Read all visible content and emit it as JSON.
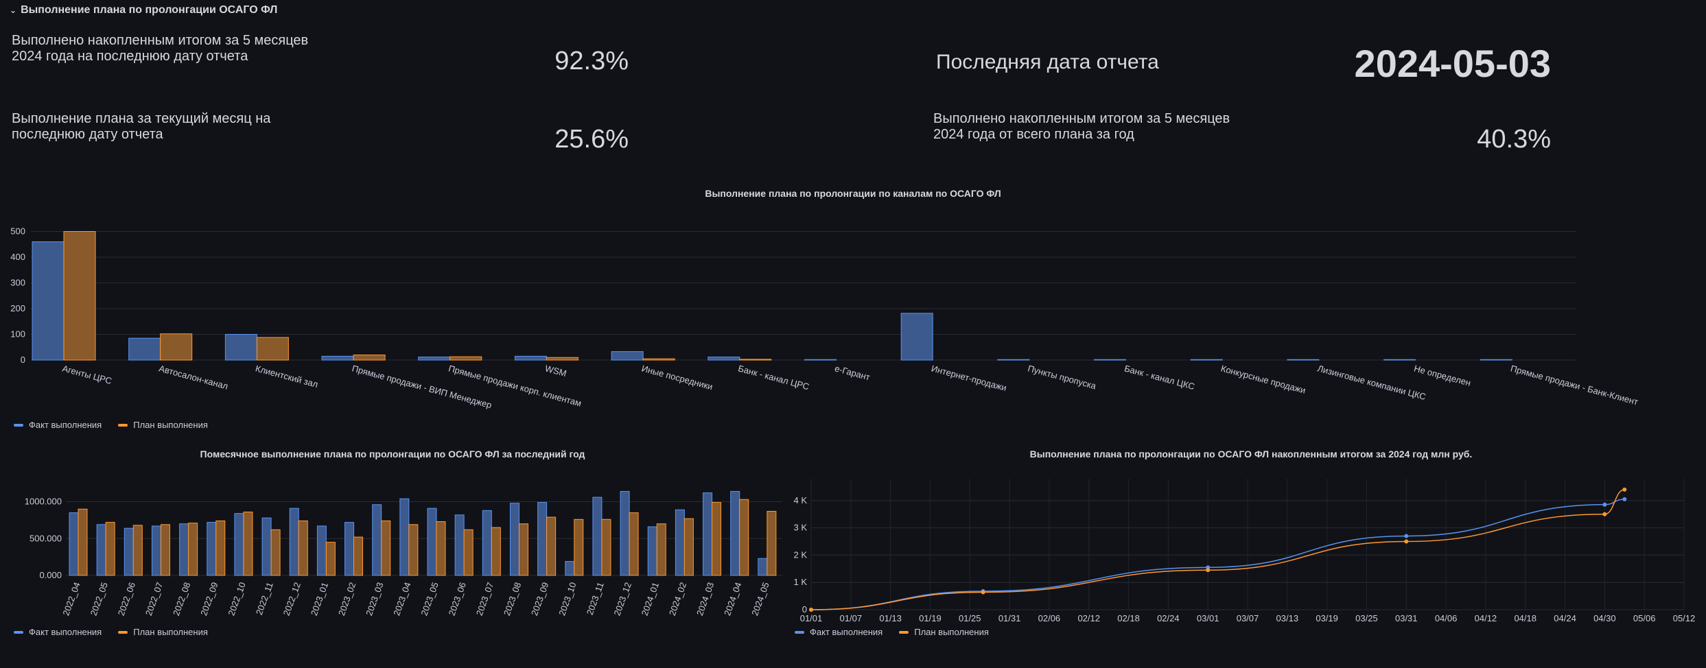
{
  "row": {
    "title": "Выполнение плана по пролонгации ОСАГО ФЛ"
  },
  "stats": [
    {
      "label": "Выполнено накопленным итогом за 5 месяцев 2024 года на последнюю дату отчета",
      "value": "92.3%"
    },
    {
      "label": "Выполнение плана за текущий месяц на последнюю дату отчета",
      "value": "25.6%"
    },
    {
      "label": "Последняя дата отчета",
      "value": "2024-05-03"
    },
    {
      "label": "Выполнено накопленным итогом за 5 месяцев 2024 года от всего плана за год",
      "value": "40.3%"
    }
  ],
  "colors": {
    "fact": "#5794f2",
    "plan": "#ff9830",
    "fact_fill": "#3d5a8f",
    "plan_fill": "#8a5a2a"
  },
  "legend": {
    "fact": "Факт выполнения",
    "plan": "План выполнения"
  },
  "chart_data": [
    {
      "type": "bar",
      "title": "Выполнение плана по пролонгации по каналам по ОСАГО ФЛ",
      "categories": [
        "Агенты ЦРС",
        "Автосалон-канал",
        "Клиентский зал",
        "Прямые продажи - ВИП Менеджер",
        "Прямые продажи корп. клиентам",
        "WSM",
        "Иные посредники",
        "Банк - канал ЦРС",
        "е-Гарант",
        "Интернет-продажи",
        "Пункты пропуска",
        "Банк - канал ЦКС",
        "Конкурсные продажи",
        "Лизинговые компании ЦКС",
        "Не определен",
        "Прямые продажи - Банк-Клиент"
      ],
      "series": [
        {
          "name": "Факт выполнения",
          "values": [
            460,
            85,
            100,
            15,
            12,
            15,
            33,
            12,
            2,
            182,
            2,
            2,
            2,
            2,
            2,
            2
          ]
        },
        {
          "name": "План выполнения",
          "values": [
            500,
            102,
            88,
            20,
            13,
            10,
            5,
            3,
            0,
            0,
            0,
            0,
            0,
            0,
            0,
            0
          ]
        }
      ],
      "ylim": [
        0,
        520
      ],
      "yticks": [
        "0",
        "100",
        "200",
        "300",
        "400",
        "500"
      ],
      "grid": true
    },
    {
      "type": "bar",
      "title": "Помесячное выполнение плана по пролонгации по ОСАГО ФЛ за последний год",
      "categories": [
        "2022_04",
        "2022_05",
        "2022_06",
        "2022_07",
        "2022_08",
        "2022_09",
        "2022_10",
        "2022_11",
        "2022_12",
        "2023_01",
        "2023_02",
        "2023_03",
        "2023_04",
        "2023_05",
        "2023_06",
        "2023_07",
        "2023_08",
        "2023_09",
        "2023_10",
        "2023_11",
        "2023_12",
        "2024_01",
        "2024_02",
        "2024_03",
        "2024_04",
        "2024_05"
      ],
      "series": [
        {
          "name": "Факт выполнения",
          "values": [
            850000,
            690000,
            640000,
            670000,
            700000,
            720000,
            840000,
            780000,
            910000,
            670000,
            720000,
            960000,
            1040000,
            910000,
            820000,
            880000,
            980000,
            990000,
            190000,
            1060000,
            1140000,
            660000,
            890000,
            1120000,
            1140000,
            230000
          ]
        },
        {
          "name": "План выполнения",
          "values": [
            900000,
            720000,
            680000,
            690000,
            710000,
            740000,
            860000,
            620000,
            740000,
            450000,
            520000,
            740000,
            690000,
            730000,
            620000,
            650000,
            700000,
            790000,
            760000,
            760000,
            850000,
            700000,
            770000,
            990000,
            1030000,
            870000
          ]
        }
      ],
      "ylim": [
        0,
        1200000
      ],
      "yticks": [
        "0.000",
        "500.000",
        "1000.000"
      ],
      "grid": true
    },
    {
      "type": "line",
      "title": "Выполнение плана по пролонгации по ОСАГО ФЛ накопленным итогом за 2024 год млн руб.",
      "x_ticks": [
        "01/01",
        "01/07",
        "01/13",
        "01/19",
        "01/25",
        "01/31",
        "02/06",
        "02/12",
        "02/18",
        "02/24",
        "03/01",
        "03/07",
        "03/13",
        "03/19",
        "03/25",
        "03/31",
        "04/06",
        "04/12",
        "04/18",
        "04/24",
        "04/30",
        "05/06",
        "05/12"
      ],
      "yticks": [
        "0",
        "1 K",
        "2 K",
        "3 K",
        "4 K"
      ],
      "ylim": [
        0,
        4800
      ],
      "x_range_days": [
        0,
        132
      ],
      "series": [
        {
          "name": "Факт выполнения",
          "x_days": [
            0,
            26,
            60,
            90,
            120,
            123
          ],
          "values": [
            0,
            680,
            1550,
            2700,
            3850,
            4050
          ],
          "markers": [
            0,
            26,
            60,
            90,
            120,
            123
          ]
        },
        {
          "name": "План выполнения",
          "x_days": [
            0,
            26,
            60,
            90,
            120,
            123
          ],
          "values": [
            0,
            640,
            1450,
            2500,
            3500,
            4400
          ],
          "markers": [
            0,
            26,
            60,
            90,
            120,
            123
          ]
        }
      ],
      "grid": true
    }
  ]
}
